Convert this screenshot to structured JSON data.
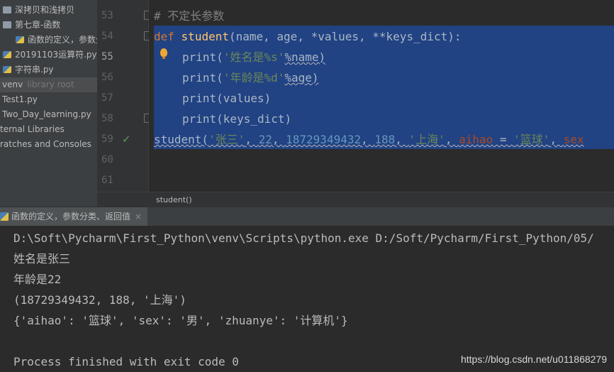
{
  "sidebar": {
    "items": [
      {
        "label": "深拷贝和浅拷贝",
        "type": "folder"
      },
      {
        "label": "第七章-函数",
        "type": "folder"
      },
      {
        "label": "函数的定义，参数分",
        "type": "py"
      },
      {
        "label": "20191103运算符.py",
        "type": "py"
      },
      {
        "label": "字符串.py",
        "type": "py"
      },
      {
        "label": "venv",
        "hint": "library root",
        "type": "venv"
      },
      {
        "label": "Test1.py",
        "type": "py"
      },
      {
        "label": "Two_Day_learning.py",
        "type": "py"
      },
      {
        "label": "ternal Libraries",
        "type": "lib"
      },
      {
        "label": "ratches and Consoles",
        "type": "lib"
      }
    ]
  },
  "gutter": {
    "line_numbers": [
      "53",
      "54",
      "55",
      "56",
      "57",
      "58",
      "59",
      "60",
      "61"
    ]
  },
  "editor": {
    "comment": "# 不定长参数",
    "def_kw": "def",
    "func_name": "student",
    "def_params": "(name, age, *values, **keys_dict):",
    "print1_fn": "print",
    "print1_open": "(",
    "print1_str": "'姓名是%s'",
    "print1_rest": "%name)",
    "print2_fn": "print",
    "print2_open": "(",
    "print2_str": "'年龄是%d'",
    "print2_rest": "%age)",
    "print3": "print(values)",
    "print4": "print(keys_dict)",
    "call_fn": "student(",
    "call_str1": "'张三'",
    "call_comma1": ", ",
    "call_num1": "22",
    "call_comma2": ", ",
    "call_num2": "18729349432",
    "call_comma3": ", ",
    "call_num3": "188",
    "call_comma4": ", ",
    "call_str2": "'上海'",
    "call_comma5": ", ",
    "call_kw1": "aihao",
    "call_eq": " = ",
    "call_str3": "'篮球'",
    "call_comma6": ", ",
    "call_kw2": "sex"
  },
  "breadcrumb": "student()",
  "run_tab": {
    "label": "函数的定义，参数分类、返回值",
    "close": "×"
  },
  "console": {
    "lines": [
      "D:\\Soft\\Pycharm\\First_Python\\venv\\Scripts\\python.exe D:/Soft/Pycharm/First_Python/05/",
      "姓名是张三",
      "年龄是22",
      "(18729349432, 188, '上海')",
      "{'aihao': '篮球', 'sex': '男', 'zhuanye': '计算机'}",
      "",
      "Process finished with exit code 0"
    ]
  },
  "watermark": "https://blog.csdn.net/u011868279",
  "colors": {
    "selection": "#214283",
    "keyword": "#cc7832",
    "function": "#ffc66d",
    "string": "#6a8759",
    "number": "#6897bb"
  }
}
